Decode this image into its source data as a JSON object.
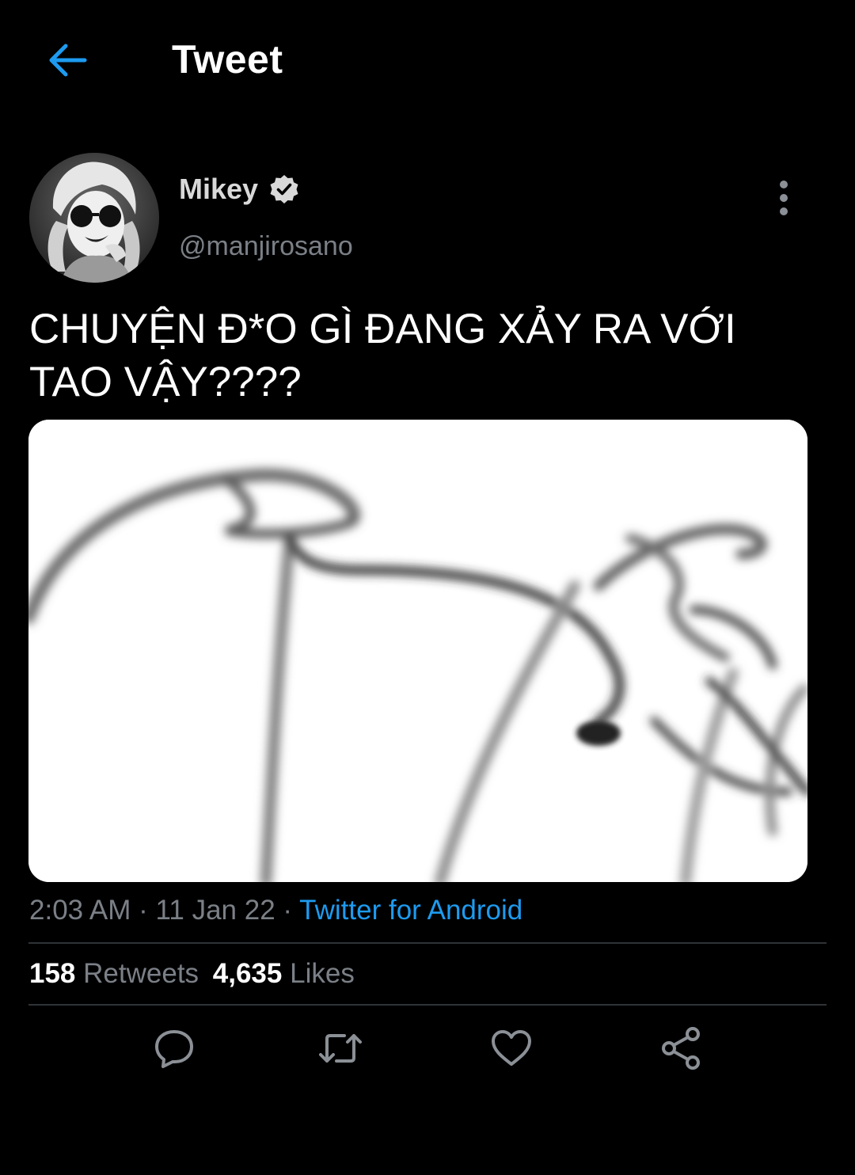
{
  "header": {
    "title": "Tweet",
    "back_icon": "arrow-left-icon"
  },
  "user": {
    "name": "Mikey",
    "handle": "@manjirosano",
    "verified": true
  },
  "tweet": {
    "line1": "CHUYỆN Đ*O GÌ ĐANG XẢY RA VỚI",
    "line2": "TAO VẬY????"
  },
  "meta": {
    "time": "2:03 AM",
    "sep1": " · ",
    "date": "11 Jan 22",
    "sep2": " · ",
    "source": "Twitter for Android"
  },
  "stats": {
    "retweets_count": "158",
    "retweets_label": "Retweets",
    "likes_count": "4,635",
    "likes_label": "Likes"
  },
  "actions": {
    "reply_icon": "reply-icon",
    "retweet_icon": "retweet-icon",
    "like_icon": "heart-icon",
    "share_icon": "share-icon"
  },
  "colors": {
    "background": "#000000",
    "accent": "#1d9bf0",
    "secondary_text": "#7b8087",
    "divider": "#2f3336"
  }
}
